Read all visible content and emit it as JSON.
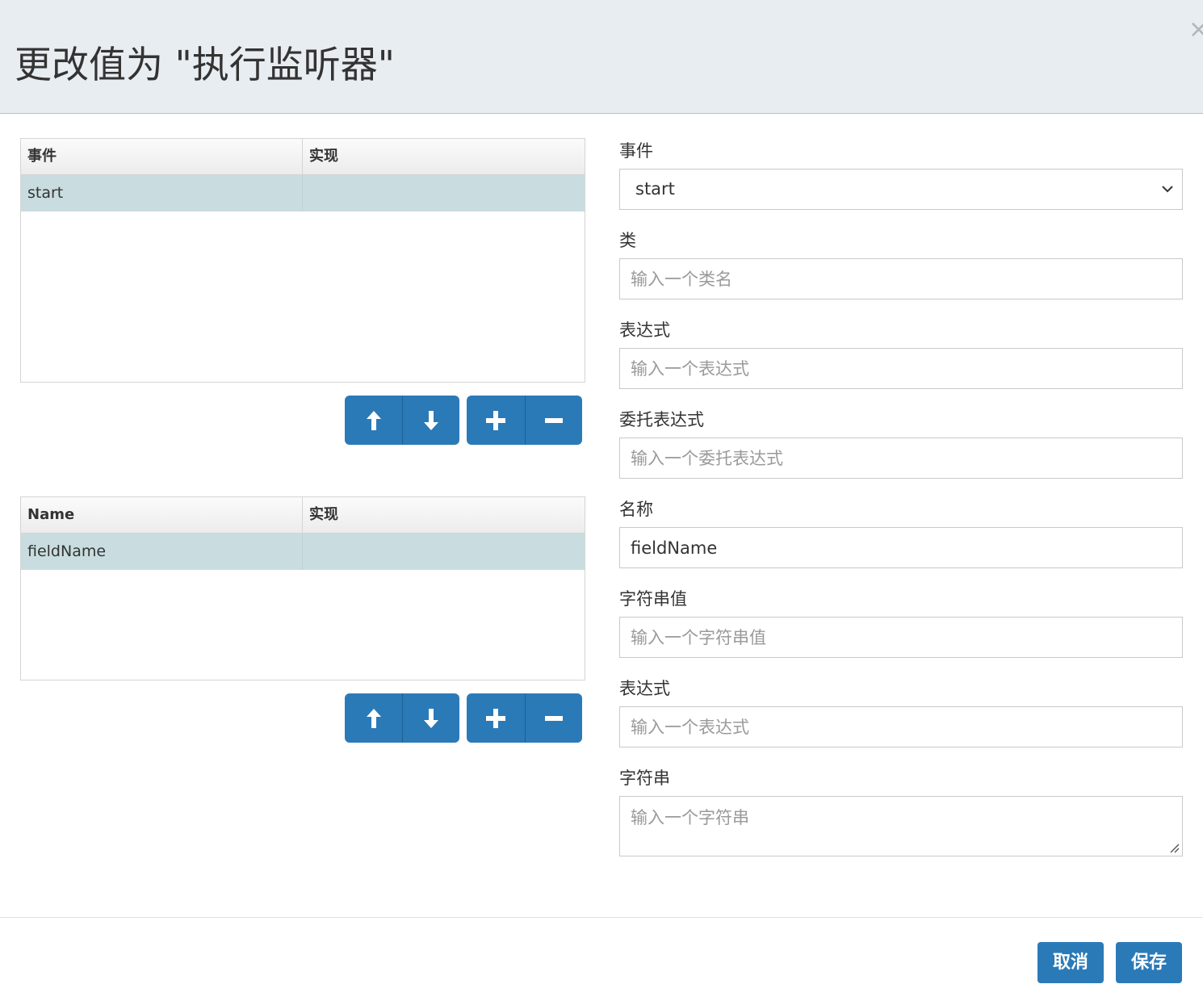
{
  "header": {
    "title": "更改值为 \"执行监听器\"",
    "close_glyph": "×"
  },
  "listeners_grid": {
    "columns": [
      "事件",
      "实现"
    ],
    "rows": [
      {
        "event": "start",
        "implementation": ""
      }
    ]
  },
  "fields_grid": {
    "columns": [
      "Name",
      "实现"
    ],
    "rows": [
      {
        "name": "fieldName",
        "implementation": ""
      }
    ]
  },
  "form": {
    "event": {
      "label": "事件",
      "value": "start"
    },
    "class": {
      "label": "类",
      "placeholder": "输入一个类名"
    },
    "expression": {
      "label": "表达式",
      "placeholder": "输入一个表达式"
    },
    "delegate_expression": {
      "label": "委托表达式",
      "placeholder": "输入一个委托表达式"
    },
    "name": {
      "label": "名称",
      "value": "fieldName"
    },
    "string_value": {
      "label": "字符串值",
      "placeholder": "输入一个字符串值"
    },
    "field_expression": {
      "label": "表达式",
      "placeholder": "输入一个表达式"
    },
    "string": {
      "label": "字符串",
      "placeholder": "输入一个字符串"
    }
  },
  "footer": {
    "cancel_label": "取消",
    "save_label": "保存"
  },
  "colors": {
    "accent": "#2b7ab8",
    "selected_row": "#c9dde0",
    "header_bg": "#e8edf1"
  }
}
